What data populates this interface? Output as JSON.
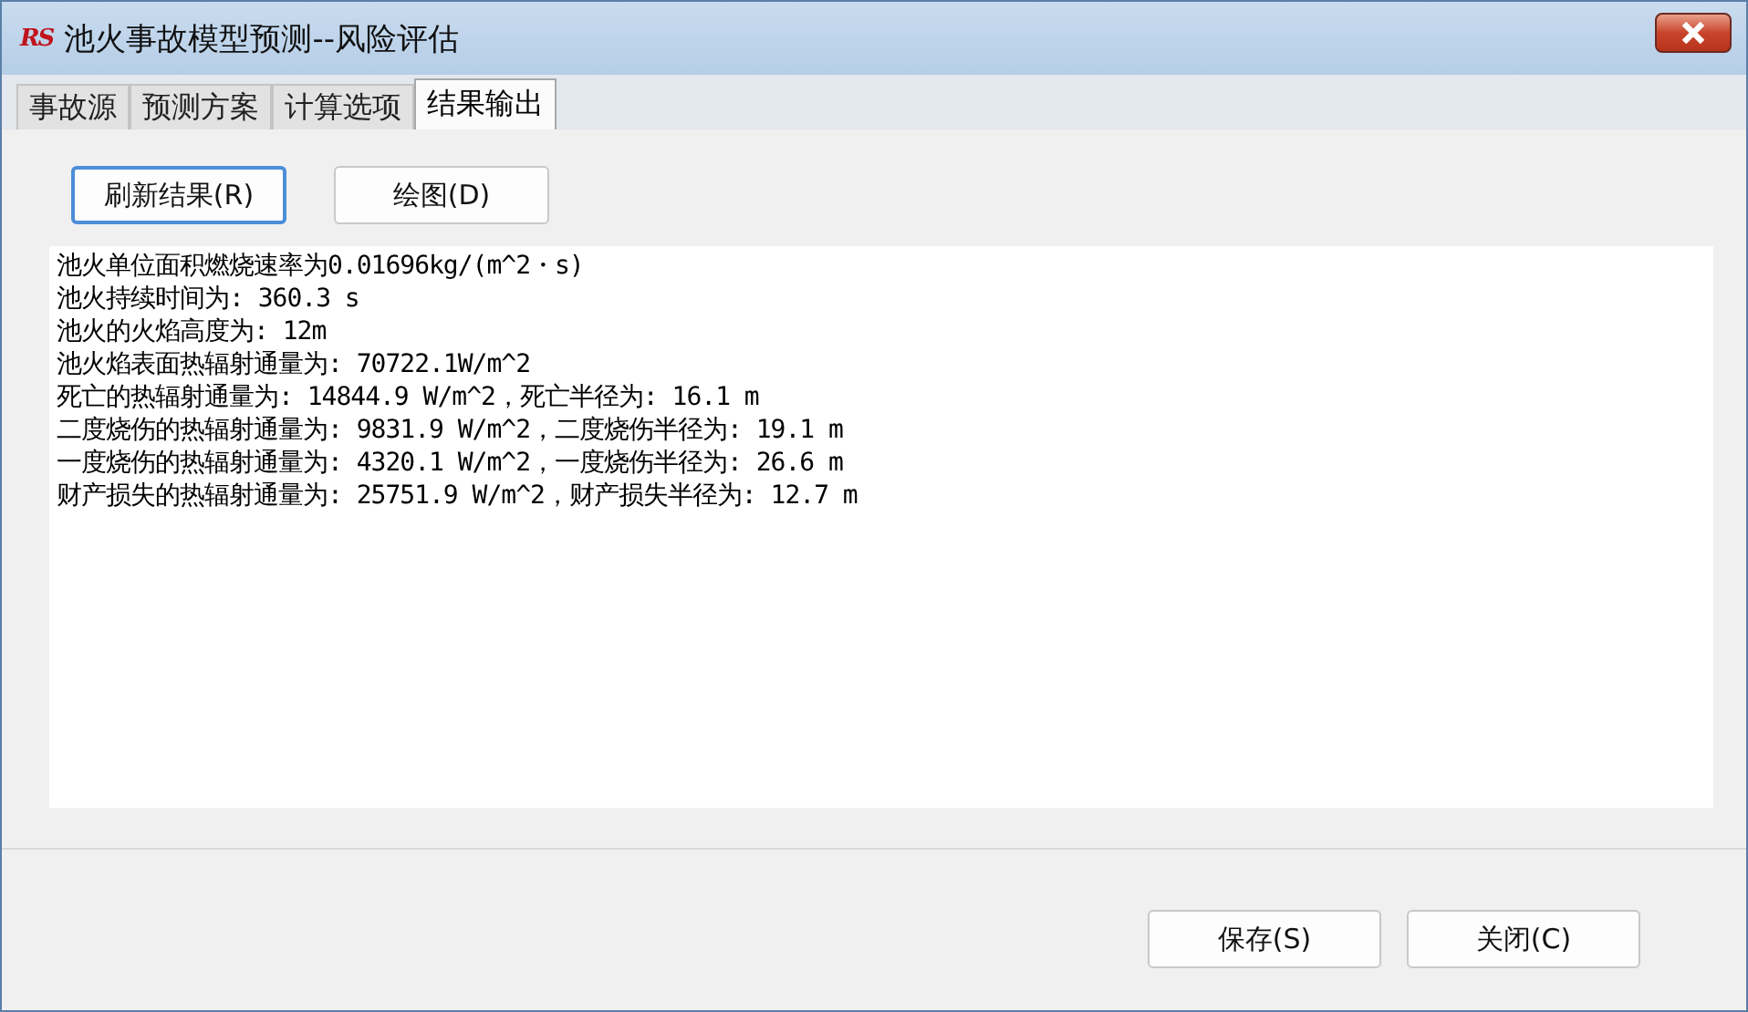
{
  "window": {
    "logo": "RS",
    "title": "池火事故模型预测--风险评估"
  },
  "tabs": [
    {
      "label": "事故源",
      "selected": false
    },
    {
      "label": "预测方案",
      "selected": false
    },
    {
      "label": "计算选项",
      "selected": false
    },
    {
      "label": "结果输出",
      "selected": true
    }
  ],
  "toolbar": [
    {
      "label": "刷新结果(R)",
      "focused": true
    },
    {
      "label": "绘图(D)",
      "focused": false
    }
  ],
  "output_lines": [
    "池火单位面积燃烧速率为0.01696kg/(m^2・s)",
    "池火持续时间为: 360.3 s",
    "池火的火焰高度为: 12m",
    "池火焰表面热辐射通量为: 70722.1W/m^2",
    "死亡的热辐射通量为: 14844.9 W/m^2，死亡半径为: 16.1 m",
    "二度烧伤的热辐射通量为: 9831.9 W/m^2，二度烧伤半径为: 19.1 m",
    "一度烧伤的热辐射通量为: 4320.1 W/m^2，一度烧伤半径为: 26.6 m",
    "财产损失的热辐射通量为: 25751.9 W/m^2，财产损失半径为: 12.7 m"
  ],
  "buttons": [
    "保存(S)",
    "关闭(C)"
  ]
}
